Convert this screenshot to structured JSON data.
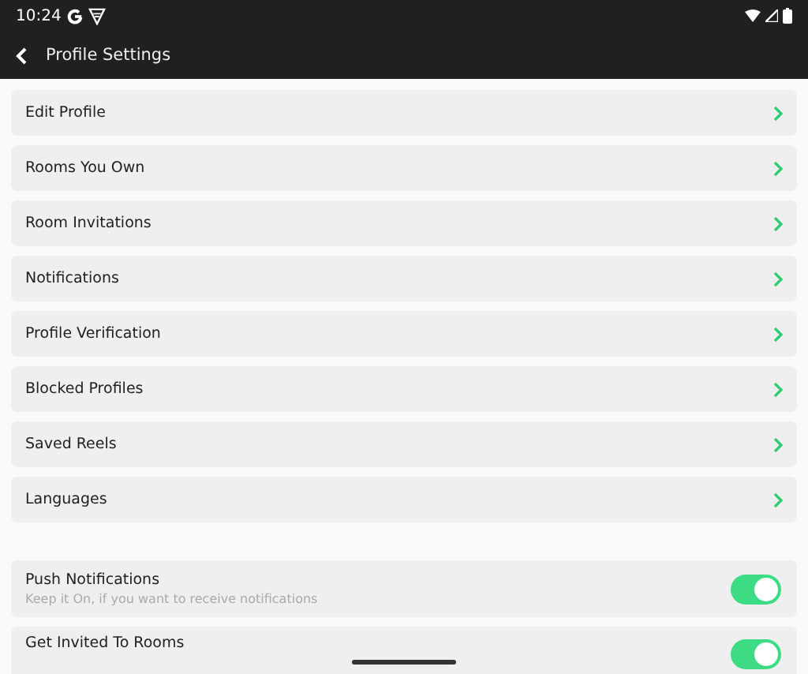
{
  "status_bar": {
    "time": "10:24"
  },
  "app_bar": {
    "title": "Profile Settings"
  },
  "menu_items": [
    {
      "label": "Edit Profile"
    },
    {
      "label": "Rooms You Own"
    },
    {
      "label": "Room Invitations"
    },
    {
      "label": "Notifications"
    },
    {
      "label": "Profile Verification"
    },
    {
      "label": "Blocked Profiles"
    },
    {
      "label": "Saved Reels"
    },
    {
      "label": "Languages"
    }
  ],
  "toggles": [
    {
      "label": "Push Notifications",
      "description": "Keep it On, if you want to receive notifications",
      "on": true
    },
    {
      "label": "Get Invited To Rooms",
      "on": true
    }
  ]
}
